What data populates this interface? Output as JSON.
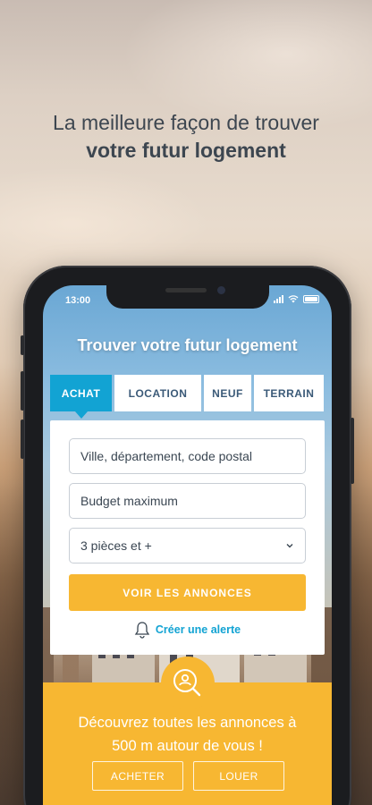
{
  "headline": {
    "line1": "La meilleure façon de trouver",
    "line2": "votre futur logement"
  },
  "status_bar": {
    "time": "13:00",
    "icons": [
      "signal-icon",
      "wifi-icon",
      "battery-icon"
    ]
  },
  "app": {
    "title": "Trouver votre futur logement",
    "tabs": [
      {
        "label": "ACHAT",
        "active": true
      },
      {
        "label": "LOCATION",
        "active": false
      },
      {
        "label": "NEUF",
        "active": false
      },
      {
        "label": "TERRAIN",
        "active": false
      }
    ],
    "form": {
      "location_placeholder": "Ville, département, code postal",
      "budget_placeholder": "Budget maximum",
      "rooms_value": "3 pièces et +",
      "submit_label": "VOIR LES ANNONCES",
      "alert_label": "Créer une alerte"
    },
    "promo": {
      "line1": "Découvrez toutes les annonces à",
      "line2": "500 m autour de vous !",
      "buy_label": "ACHETER",
      "rent_label": "LOUER"
    }
  },
  "colors": {
    "accent_blue": "#12a3d3",
    "accent_yellow": "#f7b732",
    "headline_text": "#3d4650",
    "tab_text": "#3b5a78"
  }
}
